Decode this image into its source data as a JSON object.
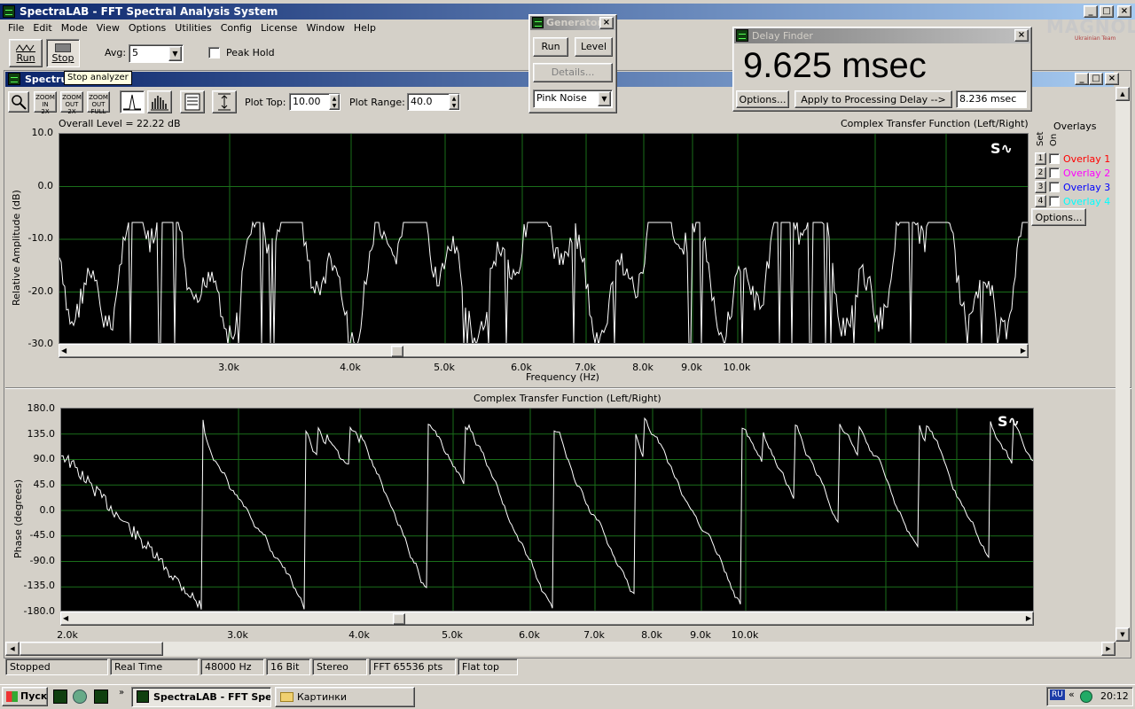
{
  "app": {
    "title": "SpectraLAB - FFT Spectral Analysis System",
    "menu": [
      "File",
      "Edit",
      "Mode",
      "View",
      "Options",
      "Utilities",
      "Config",
      "License",
      "Window",
      "Help"
    ],
    "watermark": "MAGNOLIA",
    "watermark_sub": "Ukrainian Team"
  },
  "toolbar": {
    "run_label": "Run",
    "stop_label": "Stop",
    "avg_label": "Avg:",
    "avg_value": "5",
    "peak_hold_label": "Peak Hold",
    "tooltip": "Stop analyzer"
  },
  "spectrum_window": {
    "title": "Spectrum",
    "plot_top_label": "Plot Top:",
    "plot_top_value": "10.00",
    "plot_range_label": "Plot Range:",
    "plot_range_value": "40.0",
    "zoom_in": "ZOOM IN 2X",
    "zoom_out": "ZOOM OUT 2X",
    "zoom_full": "ZOOM OUT FULL"
  },
  "amp_plot": {
    "overall_level": "Overall Level = 22.22 dB",
    "title": "Complex Transfer Function (Left/Right)",
    "ylabel": "Relative Amplitude (dB)",
    "xlabel": "Frequency (Hz)",
    "yticks": [
      "10.0",
      "0.0",
      "-10.0",
      "-20.0",
      "-30.0"
    ],
    "xticks": [
      "3.0k",
      "4.0k",
      "5.0k",
      "6.0k",
      "7.0k",
      "8.0k",
      "9.0k",
      "10.0k"
    ]
  },
  "phase_plot": {
    "title": "Complex Transfer Function (Left/Right)",
    "ylabel": "Phase (degrees)",
    "yticks": [
      "180.0",
      "135.0",
      "90.0",
      "45.0",
      "0.0",
      "-45.0",
      "-90.0",
      "-135.0",
      "-180.0"
    ],
    "xticks": [
      "2.0k",
      "3.0k",
      "4.0k",
      "5.0k",
      "6.0k",
      "7.0k",
      "8.0k",
      "9.0k",
      "10.0k"
    ]
  },
  "overlays": {
    "title": "Overlays",
    "set_label": "Set",
    "on_label": "On",
    "items": [
      {
        "num": "1",
        "label": "Overlay 1",
        "color": "#ff0000"
      },
      {
        "num": "2",
        "label": "Overlay 2",
        "color": "#ff00ff"
      },
      {
        "num": "3",
        "label": "Overlay 3",
        "color": "#0000ff"
      },
      {
        "num": "4",
        "label": "Overlay 4",
        "color": "#00ffff"
      }
    ],
    "options_label": "Options..."
  },
  "generator": {
    "title": "Generator",
    "run_label": "Run",
    "level_label": "Level",
    "details_label": "Details...",
    "signal": "Pink Noise"
  },
  "delay_finder": {
    "title": "Delay Finder",
    "delay_value": "9.625 msec",
    "options_label": "Options...",
    "apply_label": "Apply to Processing Delay -->",
    "processing_delay": "8.236 msec"
  },
  "status_bar": [
    "Stopped",
    "Real Time",
    "48000 Hz",
    "16 Bit",
    "Stereo",
    "FFT 65536 pts",
    "Flat top"
  ],
  "taskbar": {
    "start_label": "Пуск",
    "tasks": [
      "SpectraLAB - FFT Spe...",
      "Картинки"
    ],
    "lang": "RU",
    "clock": "20:12"
  },
  "colors": {
    "plot_bg": "#000000",
    "grid": "#1a6e1a",
    "trace": "#ffffff",
    "title_active": "#0a246a"
  }
}
